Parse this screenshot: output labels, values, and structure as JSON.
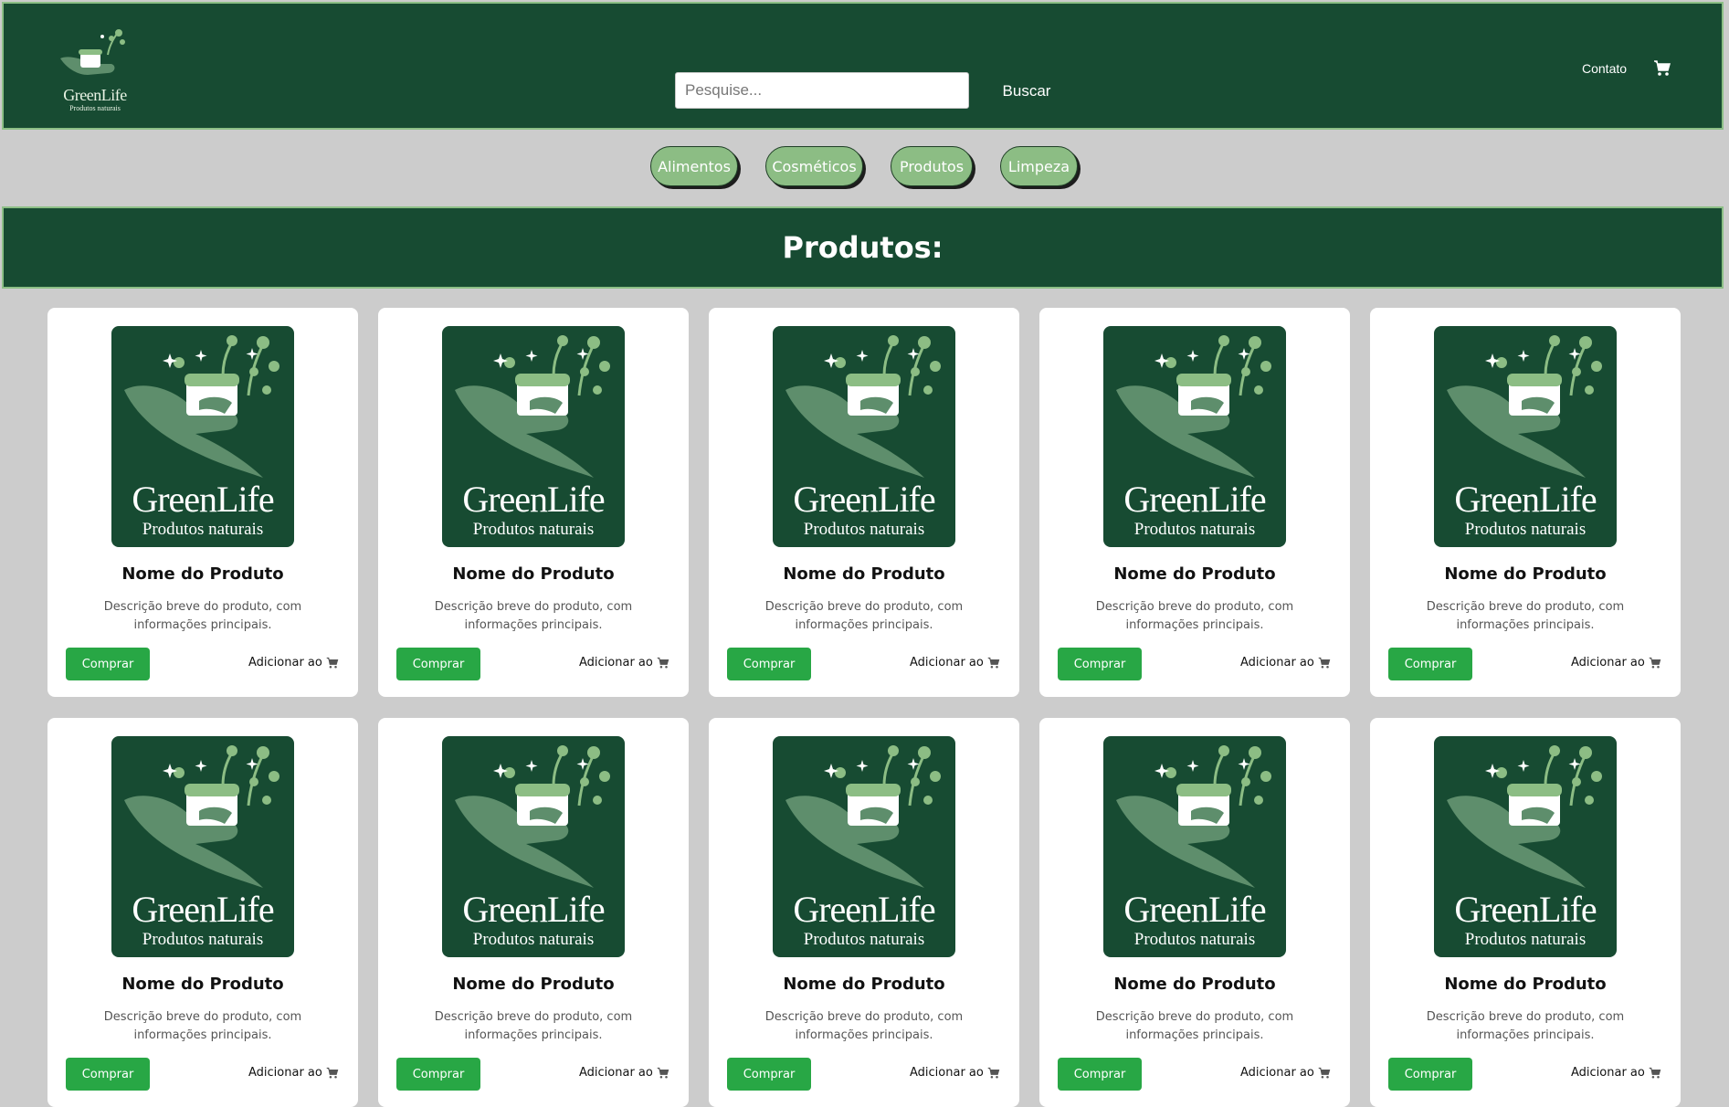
{
  "brand": {
    "name": "GreenLife",
    "tagline": "Produtos naturais"
  },
  "search": {
    "placeholder": "Pesquise...",
    "button_label": "Buscar"
  },
  "nav": {
    "contact_label": "Contato"
  },
  "categories": [
    "Alimentos",
    "Cosméticos",
    "Produtos",
    "Limpeza"
  ],
  "section_title": "Produtos:",
  "products": [
    {
      "name": "Nome do Produto",
      "description": "Descrição breve do produto, com informações principais.",
      "buy_label": "Comprar",
      "add_label": "Adicionar ao"
    },
    {
      "name": "Nome do Produto",
      "description": "Descrição breve do produto, com informações principais.",
      "buy_label": "Comprar",
      "add_label": "Adicionar ao"
    },
    {
      "name": "Nome do Produto",
      "description": "Descrição breve do produto, com informações principais.",
      "buy_label": "Comprar",
      "add_label": "Adicionar ao"
    },
    {
      "name": "Nome do Produto",
      "description": "Descrição breve do produto, com informações principais.",
      "buy_label": "Comprar",
      "add_label": "Adicionar ao"
    },
    {
      "name": "Nome do Produto",
      "description": "Descrição breve do produto, com informações principais.",
      "buy_label": "Comprar",
      "add_label": "Adicionar ao"
    },
    {
      "name": "Nome do Produto",
      "description": "Descrição breve do produto, com informações principais.",
      "buy_label": "Comprar",
      "add_label": "Adicionar ao"
    },
    {
      "name": "Nome do Produto",
      "description": "Descrição breve do produto, com informações principais.",
      "buy_label": "Comprar",
      "add_label": "Adicionar ao"
    },
    {
      "name": "Nome do Produto",
      "description": "Descrição breve do produto, com informações principais.",
      "buy_label": "Comprar",
      "add_label": "Adicionar ao"
    },
    {
      "name": "Nome do Produto",
      "description": "Descrição breve do produto, com informações principais.",
      "buy_label": "Comprar",
      "add_label": "Adicionar ao"
    },
    {
      "name": "Nome do Produto",
      "description": "Descrição breve do produto, com informações principais.",
      "buy_label": "Comprar",
      "add_label": "Adicionar ao"
    }
  ],
  "colors": {
    "header_bg": "#174b32",
    "page_bg": "#cccccc",
    "accent_light": "#8cbd84",
    "buy_button": "#28a745"
  },
  "icons": {
    "cart": "cart-icon",
    "logo": "greenlife-logo"
  }
}
